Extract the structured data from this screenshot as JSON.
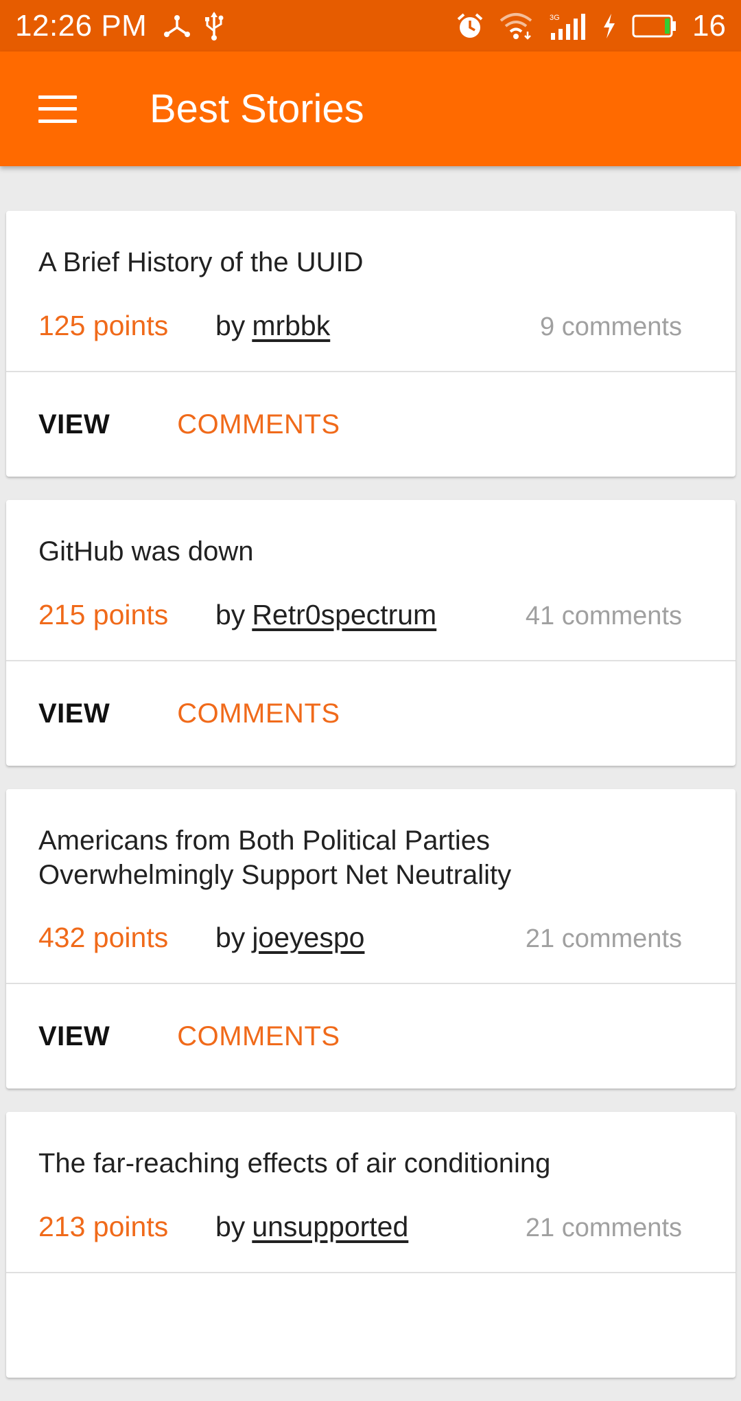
{
  "status_bar": {
    "time": "12:26 PM",
    "battery_percent": "16",
    "network_type": "3G",
    "left_icons": [
      "network-share-icon",
      "usb-icon"
    ],
    "right_icons": [
      "alarm-icon",
      "wifi-icon",
      "signal-icon",
      "charging-icon",
      "battery-icon"
    ]
  },
  "app_bar": {
    "title": "Best Stories",
    "menu_icon": "hamburger-menu-icon",
    "color": "#ff6a00"
  },
  "colors": {
    "status_bar": "#e65c00",
    "accent": "#f06a1a",
    "muted_text": "#a0a0a0",
    "background": "#ebebeb"
  },
  "stories": [
    {
      "title": "A Brief History of the UUID",
      "points": "125 points",
      "by_label": "by",
      "author": "mrbbk",
      "comments": "9 comments",
      "view_label": "VIEW",
      "comments_label": "COMMENTS"
    },
    {
      "title": "GitHub was down",
      "points": "215 points",
      "by_label": "by",
      "author": "Retr0spectrum",
      "comments": "41 comments",
      "view_label": "VIEW",
      "comments_label": "COMMENTS"
    },
    {
      "title_line1": "Americans from Both Political Parties",
      "title_line2": "Overwhelmingly Support Net Neutrality",
      "points": "432 points",
      "by_label": "by",
      "author": "joeyespo",
      "comments": "21 comments",
      "view_label": "VIEW",
      "comments_label": "COMMENTS"
    },
    {
      "title": "The far-reaching effects of air conditioning",
      "points": "213 points",
      "by_label": "by",
      "author": "unsupported",
      "comments": "21 comments"
    }
  ]
}
